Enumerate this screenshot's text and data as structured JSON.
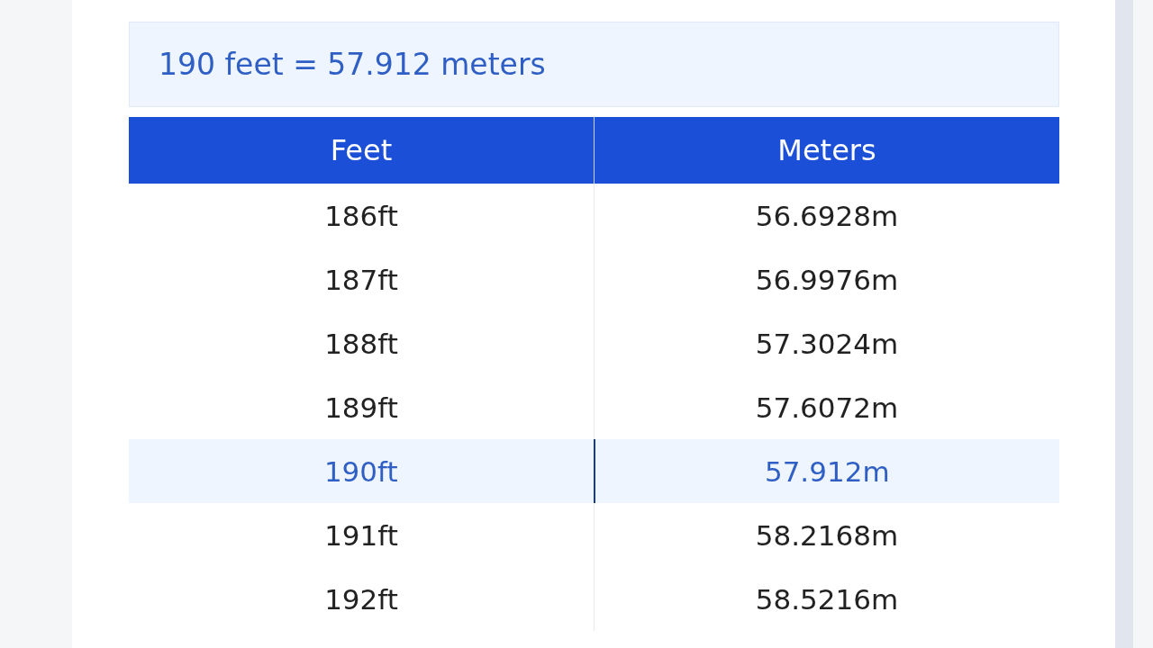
{
  "result": "190 feet = 57.912 meters",
  "table": {
    "columns": [
      "Feet",
      "Meters"
    ],
    "rows": [
      {
        "cells": [
          "186ft",
          "56.6928m"
        ],
        "selected": false
      },
      {
        "cells": [
          "187ft",
          "56.9976m"
        ],
        "selected": false
      },
      {
        "cells": [
          "188ft",
          "57.3024m"
        ],
        "selected": false
      },
      {
        "cells": [
          "189ft",
          "57.6072m"
        ],
        "selected": false
      },
      {
        "cells": [
          "190ft",
          "57.912m"
        ],
        "selected": true
      },
      {
        "cells": [
          "191ft",
          "58.2168m"
        ],
        "selected": false
      },
      {
        "cells": [
          "192ft",
          "58.5216m"
        ],
        "selected": false
      }
    ]
  }
}
